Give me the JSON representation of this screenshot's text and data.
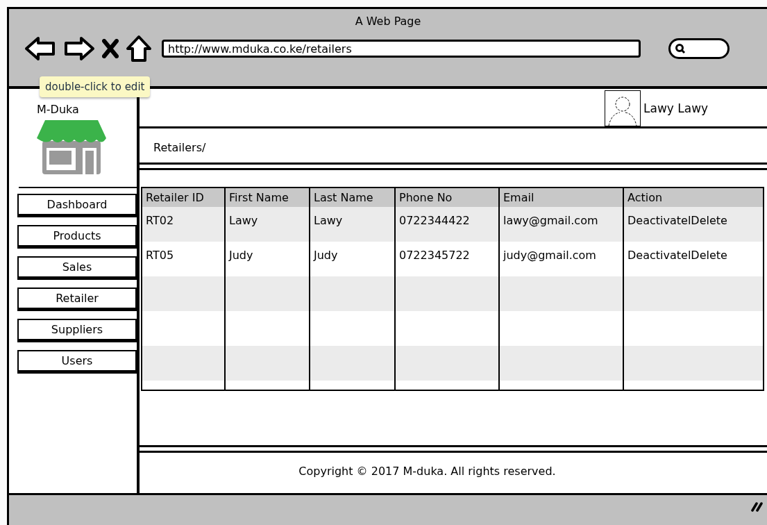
{
  "window": {
    "title": "A Web Page"
  },
  "browser": {
    "url": "http://www.mduka.co.ke/retailers"
  },
  "tooltip": {
    "text": "double-click to edit"
  },
  "sidebar": {
    "brand": "M-Duka",
    "items": [
      {
        "label": "Dashboard"
      },
      {
        "label": "Products"
      },
      {
        "label": "Sales"
      },
      {
        "label": "Retailer"
      },
      {
        "label": "Suppliers"
      },
      {
        "label": "Users"
      }
    ]
  },
  "header": {
    "user_name": "Lawy Lawy"
  },
  "breadcrumb": "Retailers/",
  "table": {
    "columns": [
      "Retailer ID",
      "First Name",
      "Last Name",
      "Phone No",
      "Email",
      "Action"
    ],
    "rows": [
      [
        "RT02",
        "Lawy",
        "Lawy",
        "0722344422",
        "lawy@gmail.com",
        "DeactivatelDelete"
      ],
      [
        "RT05",
        "Judy",
        "Judy",
        "0722345722",
        "judy@gmail.com",
        "DeactivatelDelete"
      ]
    ]
  },
  "footer": "Copyright © 2017 M-duka. All rights reserved."
}
